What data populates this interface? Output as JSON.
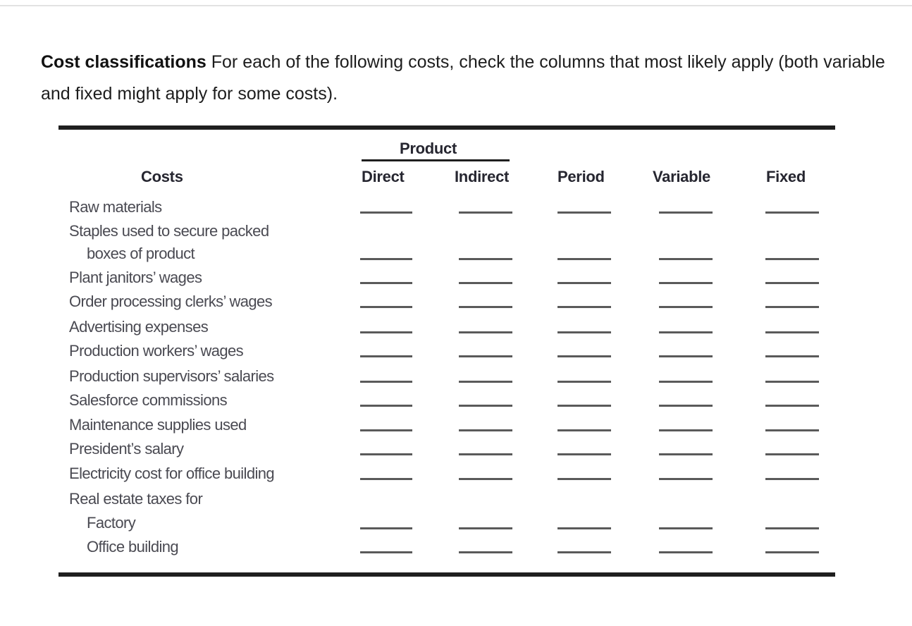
{
  "intro": {
    "title": "Cost classifications",
    "text": " For each of the following costs, check the columns that most likely apply (both variable and fixed might apply for some costs)."
  },
  "table": {
    "group_header": "Product",
    "columns": [
      "Costs",
      "Direct",
      "Indirect",
      "Period",
      "Variable",
      "Fixed"
    ],
    "rows": [
      {
        "label": "Raw materials",
        "indent": false,
        "blanks": true
      },
      {
        "label": "Staples used to secure packed",
        "indent": false,
        "blanks": false
      },
      {
        "label": "boxes of product",
        "indent": true,
        "blanks": true
      },
      {
        "label": "Plant janitors’ wages",
        "indent": false,
        "blanks": true
      },
      {
        "label": "Order processing clerks’ wages",
        "indent": false,
        "blanks": true
      },
      {
        "label": "Advertising expenses",
        "indent": false,
        "blanks": true
      },
      {
        "label": "Production workers’ wages",
        "indent": false,
        "blanks": true
      },
      {
        "label": "Production supervisors’ salaries",
        "indent": false,
        "blanks": true
      },
      {
        "label": "Salesforce commissions",
        "indent": false,
        "blanks": true
      },
      {
        "label": "Maintenance supplies used",
        "indent": false,
        "blanks": true
      },
      {
        "label": "President’s salary",
        "indent": false,
        "blanks": true
      },
      {
        "label": "Electricity cost for office building",
        "indent": false,
        "blanks": true
      },
      {
        "label": "Real estate taxes for",
        "indent": false,
        "blanks": false
      },
      {
        "label": "Factory",
        "indent": true,
        "blanks": true
      },
      {
        "label": "Office building",
        "indent": true,
        "blanks": true
      }
    ],
    "checks": {
      "Raw materials": {
        "Direct": "",
        "Indirect": "",
        "Period": "",
        "Variable": "",
        "Fixed": ""
      }
    }
  }
}
